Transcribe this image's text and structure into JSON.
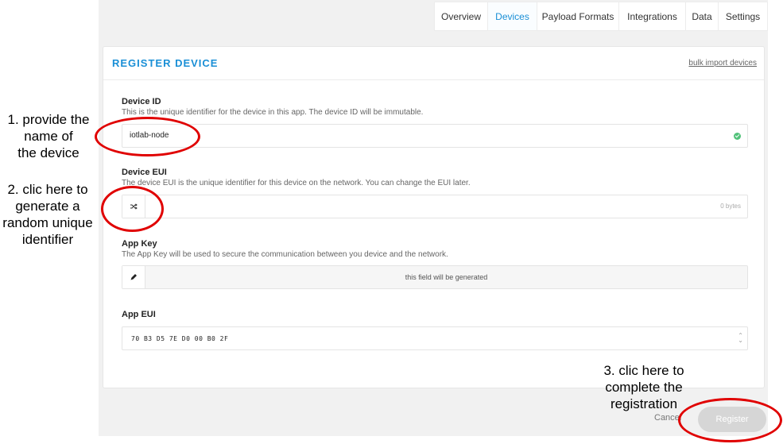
{
  "tabs": [
    {
      "label": "Overview",
      "active": false
    },
    {
      "label": "Devices",
      "active": true
    },
    {
      "label": "Payload Formats",
      "active": false
    },
    {
      "label": "Integrations",
      "active": false
    },
    {
      "label": "Data",
      "active": false
    },
    {
      "label": "Settings",
      "active": false
    }
  ],
  "card": {
    "title": "REGISTER DEVICE",
    "bulk_link": "bulk import devices"
  },
  "device_id": {
    "label": "Device ID",
    "description": "This is the unique identifier for the device in this app. The device ID will be immutable.",
    "value": "iotlab-node",
    "status_icon": "check-circle-icon"
  },
  "device_eui": {
    "label": "Device EUI",
    "description": "The device EUI is the unique identifier for this device on the network. You can change the EUI later.",
    "button_icon": "shuffle-icon",
    "byte_count": "0 bytes"
  },
  "app_key": {
    "label": "App Key",
    "description": "The App Key will be used to secure the communication between you device and the network.",
    "button_icon": "pencil-icon",
    "placeholder": "this field will be generated"
  },
  "app_eui": {
    "label": "App EUI",
    "value": "70 B3 D5 7E D0 00 B0 2F"
  },
  "actions": {
    "cancel": "Cancel",
    "register": "Register"
  },
  "annotations": {
    "step1": [
      "1. provide the",
      "name of",
      "the device"
    ],
    "step2": [
      "2. clic here to",
      "generate a",
      "random unique",
      "identifier"
    ],
    "step3": [
      "3. clic here to",
      "complete the",
      "registration"
    ],
    "highlight_color": "#e00000"
  },
  "colors": {
    "accent": "#1a8fd6",
    "success": "#52c27a",
    "register_button": "#d6d6d6"
  }
}
